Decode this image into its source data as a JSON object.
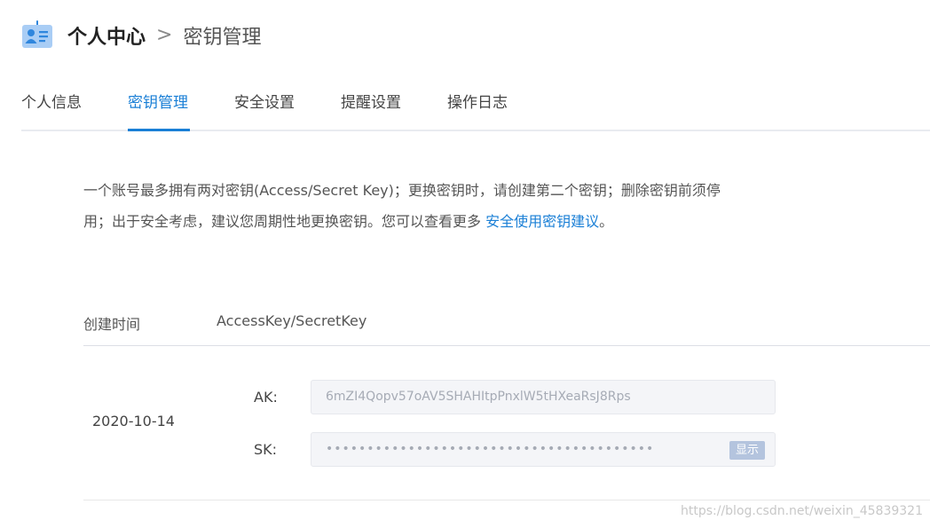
{
  "header": {
    "title": "个人中心",
    "separator": ">",
    "current": "密钥管理"
  },
  "tabs": [
    {
      "label": "个人信息"
    },
    {
      "label": "密钥管理",
      "active": true
    },
    {
      "label": "安全设置"
    },
    {
      "label": "提醒设置"
    },
    {
      "label": "操作日志"
    }
  ],
  "notice": {
    "text_line1": "一个账号最多拥有两对密钥(Access/Secret Key)；更换密钥时，请创建第二个密钥；删除密钥前须停",
    "text_line2": "用；出于安全考虑，建议您周期性地更换密钥。您可以查看更多 ",
    "link": "安全使用密钥建议",
    "suffix": "。"
  },
  "table": {
    "headers": [
      "创建时间",
      "AccessKey/SecretKey"
    ],
    "row": {
      "date": "2020-10-14",
      "ak_label": "AK:",
      "ak_value": "6mZI4Qopv57oAV5SHAHItpPnxlW5tHXeaRsJ8Rps",
      "sk_label": "SK:",
      "sk_value": "••••••••••••••••••••••••••••••••••••••••",
      "show_label": "显示"
    }
  },
  "watermark": "https://blog.csdn.net/weixin_45839321",
  "colors": {
    "accent": "#1a7fd6",
    "icon_bg": "#a9cdf5",
    "icon_fg": "#2f86dd",
    "field_bg": "#f4f5f8",
    "button_bg": "#b4c4de"
  },
  "icons": {
    "header": "id-card-icon",
    "separator": "chevron-right-icon"
  }
}
